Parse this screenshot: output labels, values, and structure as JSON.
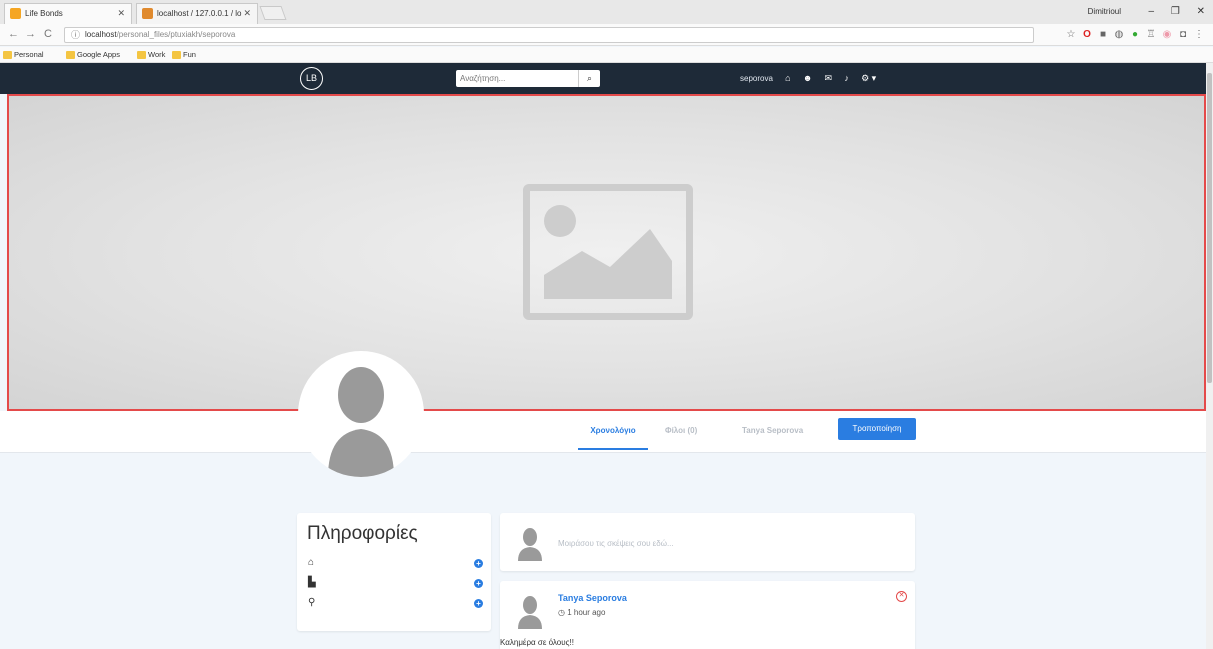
{
  "browser": {
    "tabs": [
      {
        "title": "Life Bonds",
        "favicon_color": "#f5a623"
      },
      {
        "title": "localhost / 127.0.0.1 / lo",
        "favicon_color": "#e08a2e"
      }
    ],
    "profile_name": "Dimitrioul",
    "window_controls": [
      "–",
      "❐",
      "✕"
    ],
    "nav": {
      "back": "←",
      "forward": "→",
      "reload": "C"
    },
    "address": {
      "host": "localhost",
      "path": "/personal_files/ptuxiakh/seporova"
    },
    "extension_icons": [
      "star-icon",
      "opera-icon",
      "square-icon",
      "globe-icon",
      "evernote-icon",
      "castle-icon",
      "chrome-icon",
      "pocket-icon",
      "menu-icon"
    ],
    "bookmarks": [
      "Personal",
      "Google Apps",
      "Work",
      "Fun"
    ]
  },
  "site": {
    "logo": "LB",
    "search_placeholder": "Αναζήτηση...",
    "search_icon": "search-icon",
    "username": "seporova",
    "nav_icons": [
      "home-icon",
      "friends-icon",
      "messages-icon",
      "notifications-icon",
      "settings-icon"
    ]
  },
  "cover": {
    "placeholder_icon": "image-placeholder-icon",
    "border_color": "#e44a4a"
  },
  "profile_tabs": {
    "timeline": "Χρονολόγιο",
    "friends": "Φίλοι (0)",
    "name": "Tanya Seporova",
    "edit": "Τροποποίηση"
  },
  "info": {
    "title": "Πληροφορίες",
    "rows": [
      {
        "icon": "institution-icon"
      },
      {
        "icon": "city-icon"
      },
      {
        "icon": "location-pin-icon"
      }
    ]
  },
  "composer": {
    "placeholder": "Μοιράσου τις σκέψεις σου εδώ..."
  },
  "post": {
    "author": "Tanya Seporova",
    "time": "1 hour ago",
    "body": "Καλημέρα σε όλους!!"
  },
  "colors": {
    "accent": "#2a7de1",
    "navbar": "#1e2a38",
    "danger": "#e44a4a"
  }
}
